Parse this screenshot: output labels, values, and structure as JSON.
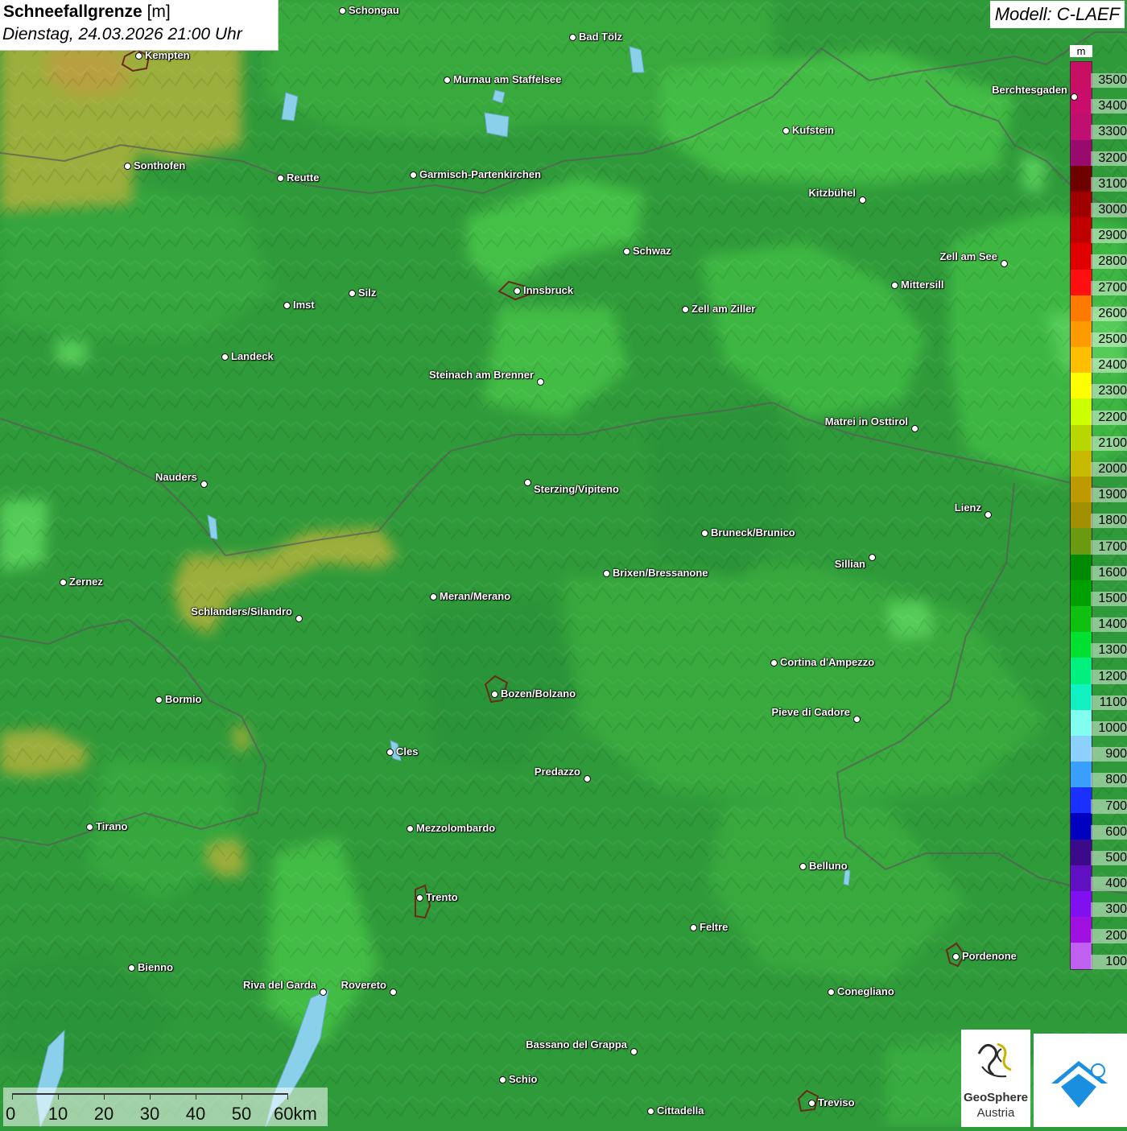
{
  "header": {
    "title_bold": "Schneefallgrenze",
    "title_unit": "[m]",
    "datetime": "Dienstag, 24.03.2026 21:00 Uhr",
    "model": "Modell: C-LAEF"
  },
  "legend": {
    "unit": "m",
    "colors": [
      "#c90f64",
      "#c80e6a",
      "#bf1072",
      "#9a0a6e",
      "#6e0000",
      "#a00000",
      "#c00000",
      "#e00000",
      "#ff1010",
      "#ff7a00",
      "#ff9a00",
      "#ffbe00",
      "#ffff00",
      "#ccff00",
      "#b8d600",
      "#c7b800",
      "#bf9900",
      "#a09000",
      "#6a9a10",
      "#008a00",
      "#00a000",
      "#10c010",
      "#00e030",
      "#00f080",
      "#10f0c0",
      "#80fff0",
      "#8cd0ff",
      "#3aa0ff",
      "#1a30ff",
      "#0000c0",
      "#3a0a8a",
      "#6010c0",
      "#8010f0",
      "#a010e0",
      "#c060f0"
    ],
    "labels": [
      "3500",
      "3400",
      "3300",
      "3200",
      "3100",
      "3000",
      "2900",
      "2800",
      "2700",
      "2600",
      "2500",
      "2400",
      "2300",
      "2200",
      "2100",
      "2000",
      "1900",
      "1800",
      "1700",
      "1600",
      "1500",
      "1400",
      "1300",
      "1200",
      "1100",
      "1000",
      "900",
      "800",
      "700",
      "600",
      "500",
      "400",
      "300",
      "200",
      "100"
    ]
  },
  "cities": [
    {
      "name": "Schongau"
    },
    {
      "name": "Bad Tölz"
    },
    {
      "name": "Kempten"
    },
    {
      "name": "Murnau am Staffelsee"
    },
    {
      "name": "Berchtesgaden"
    },
    {
      "name": "Kufstein"
    },
    {
      "name": "Sonthofen"
    },
    {
      "name": "Reutte"
    },
    {
      "name": "Garmisch-Partenkirchen"
    },
    {
      "name": "Kitzbühel"
    },
    {
      "name": "Schwaz"
    },
    {
      "name": "Zell am See"
    },
    {
      "name": "Mittersill"
    },
    {
      "name": "Innsbruck"
    },
    {
      "name": "Silz"
    },
    {
      "name": "Imst"
    },
    {
      "name": "Zell am Ziller"
    },
    {
      "name": "Landeck"
    },
    {
      "name": "Steinach am Brenner"
    },
    {
      "name": "Matrei in Osttirol"
    },
    {
      "name": "Nauders"
    },
    {
      "name": "Sterzing/Vipiteno"
    },
    {
      "name": "Lienz"
    },
    {
      "name": "Bruneck/Brunico"
    },
    {
      "name": "Sillian"
    },
    {
      "name": "Brixen/Bressanone"
    },
    {
      "name": "Zernez"
    },
    {
      "name": "Meran/Merano"
    },
    {
      "name": "Schlanders/Silandro"
    },
    {
      "name": "Cortina d'Ampezzo"
    },
    {
      "name": "Bozen/Bolzano"
    },
    {
      "name": "Bormio"
    },
    {
      "name": "Pieve di Cadore"
    },
    {
      "name": "Cles"
    },
    {
      "name": "Predazzo"
    },
    {
      "name": "Tirano"
    },
    {
      "name": "Mezzolombardo"
    },
    {
      "name": "Belluno"
    },
    {
      "name": "Trento"
    },
    {
      "name": "Feltre"
    },
    {
      "name": "Pordenone"
    },
    {
      "name": "Bienno"
    },
    {
      "name": "Riva del Garda"
    },
    {
      "name": "Rovereto"
    },
    {
      "name": "Conegliano"
    },
    {
      "name": "Bassano del Grappa"
    },
    {
      "name": "Schio"
    },
    {
      "name": "Treviso"
    },
    {
      "name": "Cittadella"
    }
  ],
  "scalebar": {
    "labels": [
      "0",
      "10",
      "20",
      "30",
      "40",
      "50",
      "60km"
    ]
  },
  "logos": {
    "geosphere_line1": "GeoSphere",
    "geosphere_line2": "Austria"
  }
}
